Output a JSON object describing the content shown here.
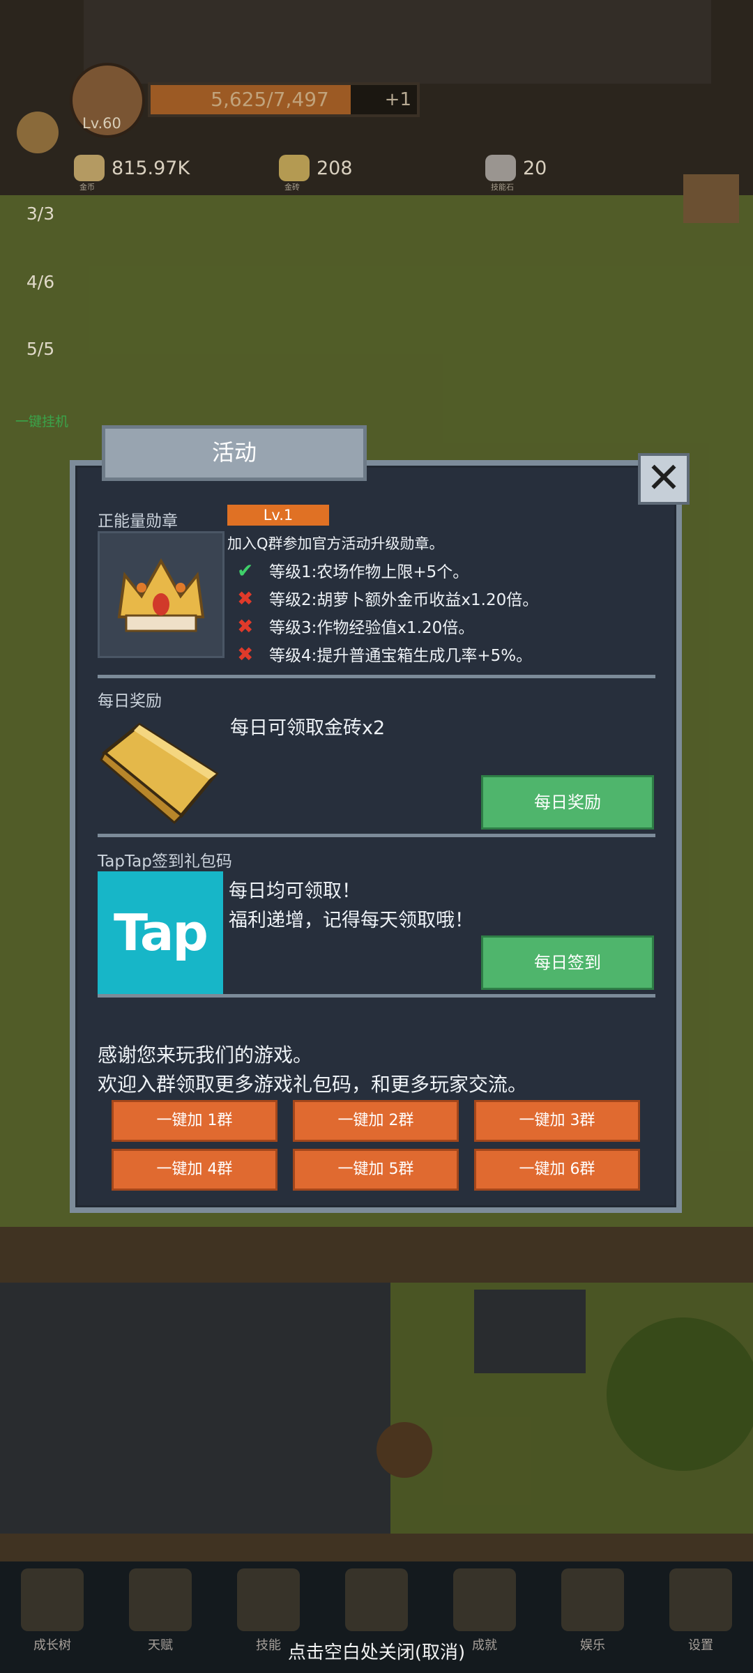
{
  "hud": {
    "level": "Lv.60",
    "exp": "5,625/7,497",
    "exp_ratio": 0.75,
    "exp_plus": "+1",
    "coins": {
      "value": "815.97K",
      "caption": "金币"
    },
    "gold_bricks": {
      "value": "208",
      "caption": "金砖"
    },
    "skill_stones": {
      "value": "20",
      "caption": "技能石"
    },
    "side_counts": [
      "3/3",
      "4/6",
      "5/5"
    ],
    "side_label": "一键挂机"
  },
  "modal": {
    "title": "活动",
    "close_icon": "close-icon",
    "medal": {
      "label": "正能量勋章",
      "level": "Lv.1",
      "desc": "加入Q群参加官方活动升级勋章。",
      "perks": [
        {
          "text": "等级1:农场作物上限+5个。",
          "unlocked": true
        },
        {
          "text": "等级2:胡萝卜额外金币收益x1.20倍。",
          "unlocked": false
        },
        {
          "text": "等级3:作物经验值x1.20倍。",
          "unlocked": false
        },
        {
          "text": "等级4:提升普通宝箱生成几率+5%。",
          "unlocked": false
        }
      ]
    },
    "daily": {
      "label": "每日奖励",
      "desc": "每日可领取金砖x2",
      "button": "每日奖励"
    },
    "taptap": {
      "label": "TapTap签到礼包码",
      "logo": "Tap",
      "line1": "每日均可领取！",
      "line2": "福利递增，记得每天领取哦！",
      "button": "每日签到"
    },
    "thanks_line1": "感谢您来玩我们的游戏。",
    "thanks_line2": "欢迎入群领取更多游戏礼包码，和更多玩家交流。",
    "group_buttons": [
      "一键加 1群",
      "一键加 2群",
      "一键加 3群",
      "一键加 4群",
      "一键加 5群",
      "一键加 6群"
    ]
  },
  "nav": [
    "成长树",
    "天赋",
    "技能",
    "",
    "成就",
    "娱乐",
    "设置"
  ],
  "close_hint": "点击空白处关闭(取消)"
}
